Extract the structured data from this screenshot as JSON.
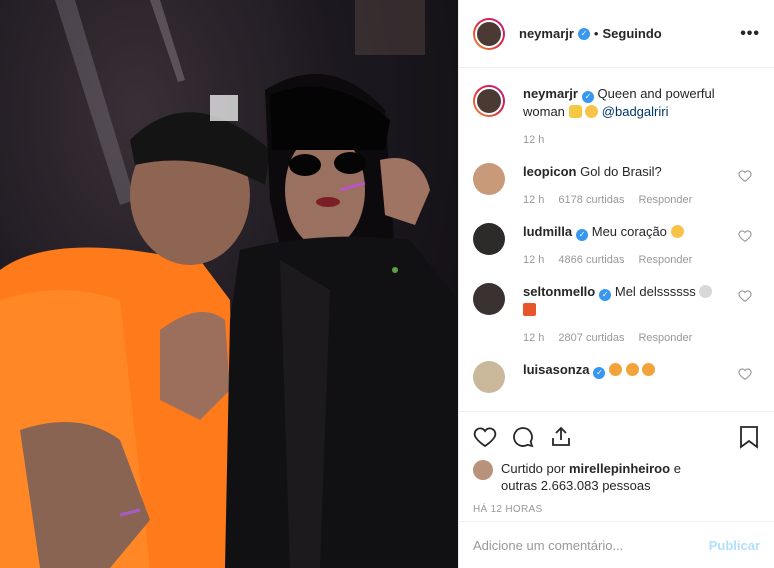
{
  "post": {
    "image_alt": "Photo"
  },
  "header": {
    "username": "neymarjr",
    "dot": "•",
    "following": "Seguindo",
    "more": "•••"
  },
  "caption": {
    "username": "neymarjr",
    "text": "Queen and powerful woman",
    "mention": "@badgalriri",
    "time": "12 h"
  },
  "comments": [
    {
      "username": "leopicon",
      "text": "Gol do Brasil?",
      "time": "12 h",
      "likes": "6178 curtidas",
      "reply": "Responder"
    },
    {
      "username": "ludmilla",
      "text": "Meu coração",
      "time": "12 h",
      "likes": "4866 curtidas",
      "reply": "Responder"
    },
    {
      "username": "seltonmello",
      "text": "Mel delssssss",
      "time": "12 h",
      "likes": "2807 curtidas",
      "reply": "Responder"
    },
    {
      "username": "luisasonza",
      "text": "",
      "time": "",
      "likes": "",
      "reply": ""
    }
  ],
  "likes": {
    "prefix": "Curtido por",
    "user": "mirellepinheiroo",
    "and": "e",
    "others": "outras 2.663.083 pessoas"
  },
  "time_ago": "HÁ 12 HORAS",
  "add_comment": {
    "placeholder": "Adicione um comentário...",
    "publish": "Publicar"
  },
  "colors": {
    "verified": "#3897f0",
    "link": "#003569",
    "muted": "#999999",
    "publish_disabled": "#b2dffc"
  }
}
